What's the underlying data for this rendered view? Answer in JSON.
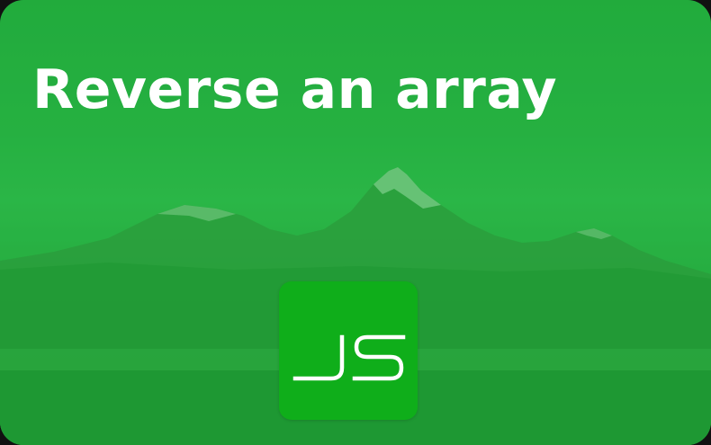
{
  "banner": {
    "title": "Reverse an array",
    "logo_text": "JS"
  },
  "colors": {
    "background": "#25b041",
    "logo_background": "#0fae1a",
    "text": "#ffffff"
  },
  "icons": {
    "logo": "javascript-logo-icon"
  }
}
